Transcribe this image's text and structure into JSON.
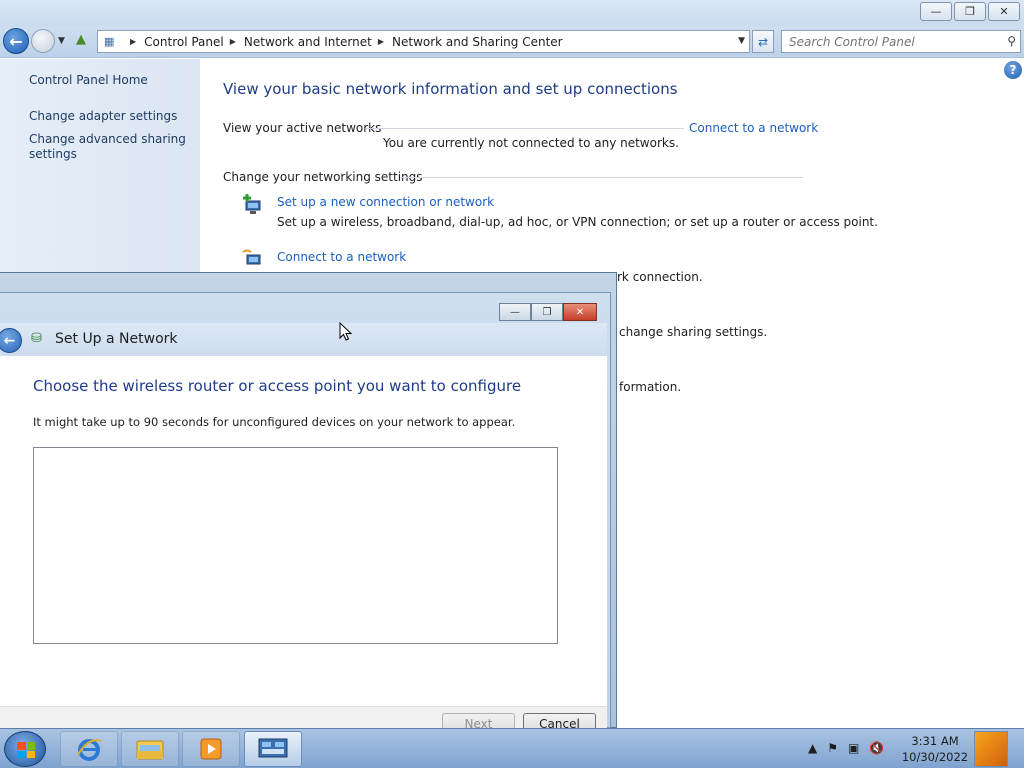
{
  "explorer": {
    "breadcrumb": [
      "Control Panel",
      "Network and Internet",
      "Network and Sharing Center"
    ],
    "search_placeholder": "Search Control Panel",
    "window_buttons": {
      "minimize": "—",
      "restore": "❐",
      "close": "✕"
    },
    "sidebar": {
      "home": "Control Panel Home",
      "links": [
        "Change adapter settings",
        "Change advanced sharing settings"
      ]
    },
    "content": {
      "heading": "View your basic network information and set up connections",
      "active_networks_label": "View your active networks",
      "connect_link": "Connect to a network",
      "not_connected": "You are currently not connected to any networks.",
      "change_settings_label": "Change your networking settings",
      "tasks": [
        {
          "title": "Set up a new connection or network",
          "desc": "Set up a wireless, broadband, dial-up, ad hoc, or VPN connection; or set up a router or access point."
        },
        {
          "title": "Connect to a network",
          "desc": ""
        }
      ],
      "partial_texts": [
        "rk connection.",
        "change sharing settings.",
        "formation."
      ]
    }
  },
  "dialog": {
    "title": "Set Up a Network",
    "heading": "Choose the wireless router or access point you want to configure",
    "note": "It might take up to 90 seconds for unconfigured devices on your network to appear.",
    "next_label": "Next",
    "cancel_label": "Cancel"
  },
  "taskbar": {
    "time": "3:31 AM",
    "date": "10/30/2022"
  },
  "colors": {
    "link": "#1a5ec2",
    "heading": "#1e3c87",
    "taskbar": "#7fa3cf",
    "sidebar": "#e0eaf6"
  }
}
